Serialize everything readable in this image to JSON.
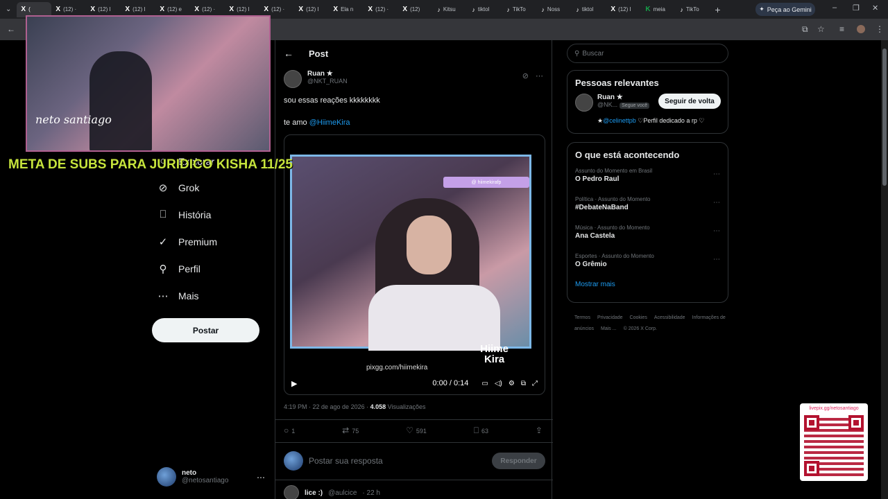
{
  "browser": {
    "tabs": [
      {
        "glyph": "X",
        "label": "(",
        "active": true
      },
      {
        "glyph": "X",
        "label": "(12) ·"
      },
      {
        "glyph": "X",
        "label": "(12) I"
      },
      {
        "glyph": "X",
        "label": "(12) I"
      },
      {
        "glyph": "X",
        "label": "(12) e"
      },
      {
        "glyph": "X",
        "label": "(12) ·"
      },
      {
        "glyph": "X",
        "label": "(12) I"
      },
      {
        "glyph": "X",
        "label": "(12) ·"
      },
      {
        "glyph": "X",
        "label": "(12) I"
      },
      {
        "glyph": "X",
        "label": "Ela n"
      },
      {
        "glyph": "X",
        "label": "(12) ·"
      },
      {
        "glyph": "X",
        "label": "(12)"
      },
      {
        "glyph": "♪",
        "label": "Kitsu"
      },
      {
        "glyph": "♪",
        "label": "tiktol"
      },
      {
        "glyph": "♪",
        "label": "TikTo"
      },
      {
        "glyph": "♪",
        "label": "Noss"
      },
      {
        "glyph": "♪",
        "label": "tiktol"
      },
      {
        "glyph": "X",
        "label": "(12) I"
      },
      {
        "glyph": "K",
        "label": "meia"
      },
      {
        "glyph": "♪",
        "label": "TikTo"
      }
    ],
    "gemini_label": "Peça ao Gemini"
  },
  "overlay": {
    "signature": "neto santiago",
    "banner": "META DE SUBS PARA JURIDICO KISHA 11/25",
    "qr_url": "livepix.gg/netosantiago"
  },
  "nav": {
    "items": [
      {
        "icon": "search-icon",
        "glyph": "○",
        "label": "Explorar"
      },
      {
        "icon": "grok-icon",
        "glyph": "⊘",
        "label": "Grok"
      },
      {
        "icon": "bookmark-icon",
        "glyph": "⎕",
        "label": "História"
      },
      {
        "icon": "premium-icon",
        "glyph": "✓",
        "label": "Premium"
      },
      {
        "icon": "profile-icon",
        "glyph": "⚲",
        "label": "Perfil"
      },
      {
        "icon": "more-icon",
        "glyph": "⋯",
        "label": "Mais"
      }
    ],
    "post_button": "Postar",
    "account": {
      "name": "neto",
      "handle": "@netosantiago"
    }
  },
  "post": {
    "header": "Post",
    "author": {
      "name": "Ruan ★",
      "handle": "@NKT_RUAN"
    },
    "text_line1": "sou essas reações kkkkkkkk",
    "text_line2_prefix": "te amo ",
    "mention": "@HiimeKira",
    "video": {
      "tag": "@ hiimekirafp",
      "brand_line1": "Hiime",
      "brand_line2": "Kira",
      "site": "pixgg.com/hiimekira",
      "time": "0:00 / 0:14"
    },
    "meta_time": "4:19 PM · 22 de ago de 2026 · ",
    "views_count": "4.058",
    "views_label": " Visualizações",
    "actions": {
      "replies": "1",
      "reposts": "75",
      "likes": "591",
      "bookmarks": "63"
    },
    "reply_placeholder": "Postar sua resposta",
    "reply_button": "Responder",
    "next_reply": {
      "name": "lice :)",
      "handle": "@aulcice",
      "age": "· 22 h"
    }
  },
  "sidebar": {
    "search_placeholder": "Buscar",
    "relevant": {
      "title": "Pessoas relevantes",
      "name": "Ruan ★",
      "handle": "@NK...",
      "badge": "Segue você",
      "follow": "Seguir de volta",
      "bio_prefix": "★",
      "bio_mention": "@celinettpb",
      "bio_rest": " ♡Perfil dedicado a rp ♡"
    },
    "trends": {
      "title": "O que está acontecendo",
      "items": [
        {
          "context": "Assunto do Momento em Brasil",
          "topic": "O Pedro Raul"
        },
        {
          "context": "Política · Assunto do Momento",
          "topic": "#DebateNaBand"
        },
        {
          "context": "Música · Assunto do Momento",
          "topic": "Ana Castela"
        },
        {
          "context": "Esportes · Assunto do Momento",
          "topic": "O Grêmio"
        }
      ],
      "more": "Mostrar mais"
    },
    "footer": [
      "Termos",
      "Privacidade",
      "Cookies",
      "Acessibilidade",
      "Informações de anúncios",
      "Mais ...",
      "© 2026 X Corp."
    ]
  }
}
